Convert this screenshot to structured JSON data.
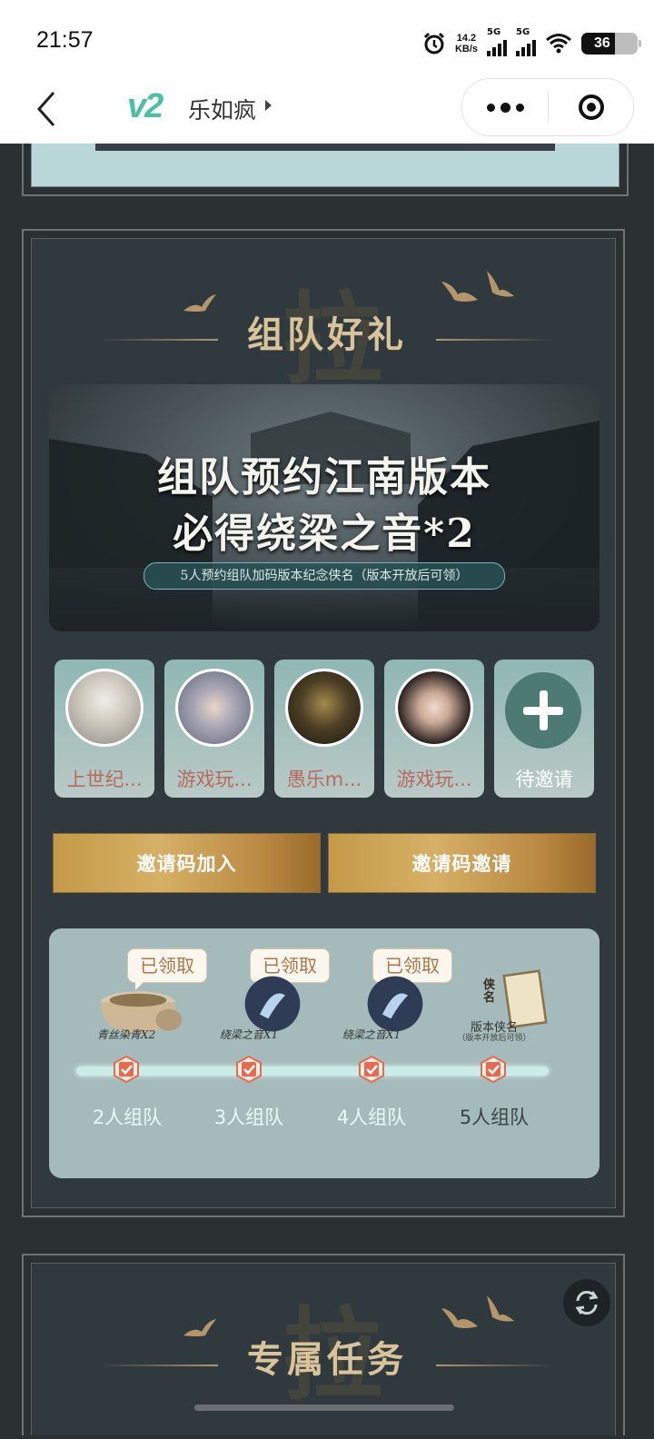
{
  "status_bar": {
    "time": "21:57",
    "net_speed_value": "14.2",
    "net_speed_unit": "KB/s",
    "signal1_label": "5G",
    "signal2_label": "5G",
    "battery": "36"
  },
  "nav": {
    "logo": "v2",
    "title": "乐如疯"
  },
  "team_section": {
    "title": "组队好礼",
    "watermark": "拉",
    "banner": {
      "line1": "组队预约江南版本",
      "line2": "必得绕梁之音*2",
      "ribbon": "5人预约组队加码版本纪念侠名（版本开放后可领）"
    },
    "members": [
      {
        "name": "上世纪...",
        "avatar": "white-haired-elder-avatar"
      },
      {
        "name": "游戏玩...",
        "avatar": "silver-haired-youth-avatar"
      },
      {
        "name": "愚乐m...",
        "avatar": "masked-demon-avatar"
      },
      {
        "name": "游戏玩...",
        "avatar": "dark-haired-woman-avatar"
      }
    ],
    "invite_slot": {
      "label": "待邀请"
    },
    "buttons": {
      "join_by_code": "邀请码加入",
      "invite_by_code": "邀请码邀请"
    },
    "rewards": {
      "claimed_label": "已领取",
      "items": [
        {
          "name": "青丝染青X2",
          "note": "",
          "claimed": true
        },
        {
          "name": "绕梁之音X1",
          "note": "",
          "claimed": true
        },
        {
          "name": "绕梁之音X1",
          "note": "",
          "claimed": true
        },
        {
          "name": "版本侠名",
          "note": "（版本开放后可领）",
          "claimed": false
        }
      ],
      "milestones": [
        "2人组队",
        "3人组队",
        "4人组队",
        "5人组队"
      ],
      "scroll_text": "侠名"
    }
  },
  "task_section": {
    "title": "专属任务",
    "watermark": "拉"
  },
  "colors": {
    "accent_gold": "#d8c39a",
    "button_gold": "#c49a48",
    "check_red": "#e8694e",
    "member_name": "#b86a5e",
    "logo_green": "#4bbfa3"
  }
}
